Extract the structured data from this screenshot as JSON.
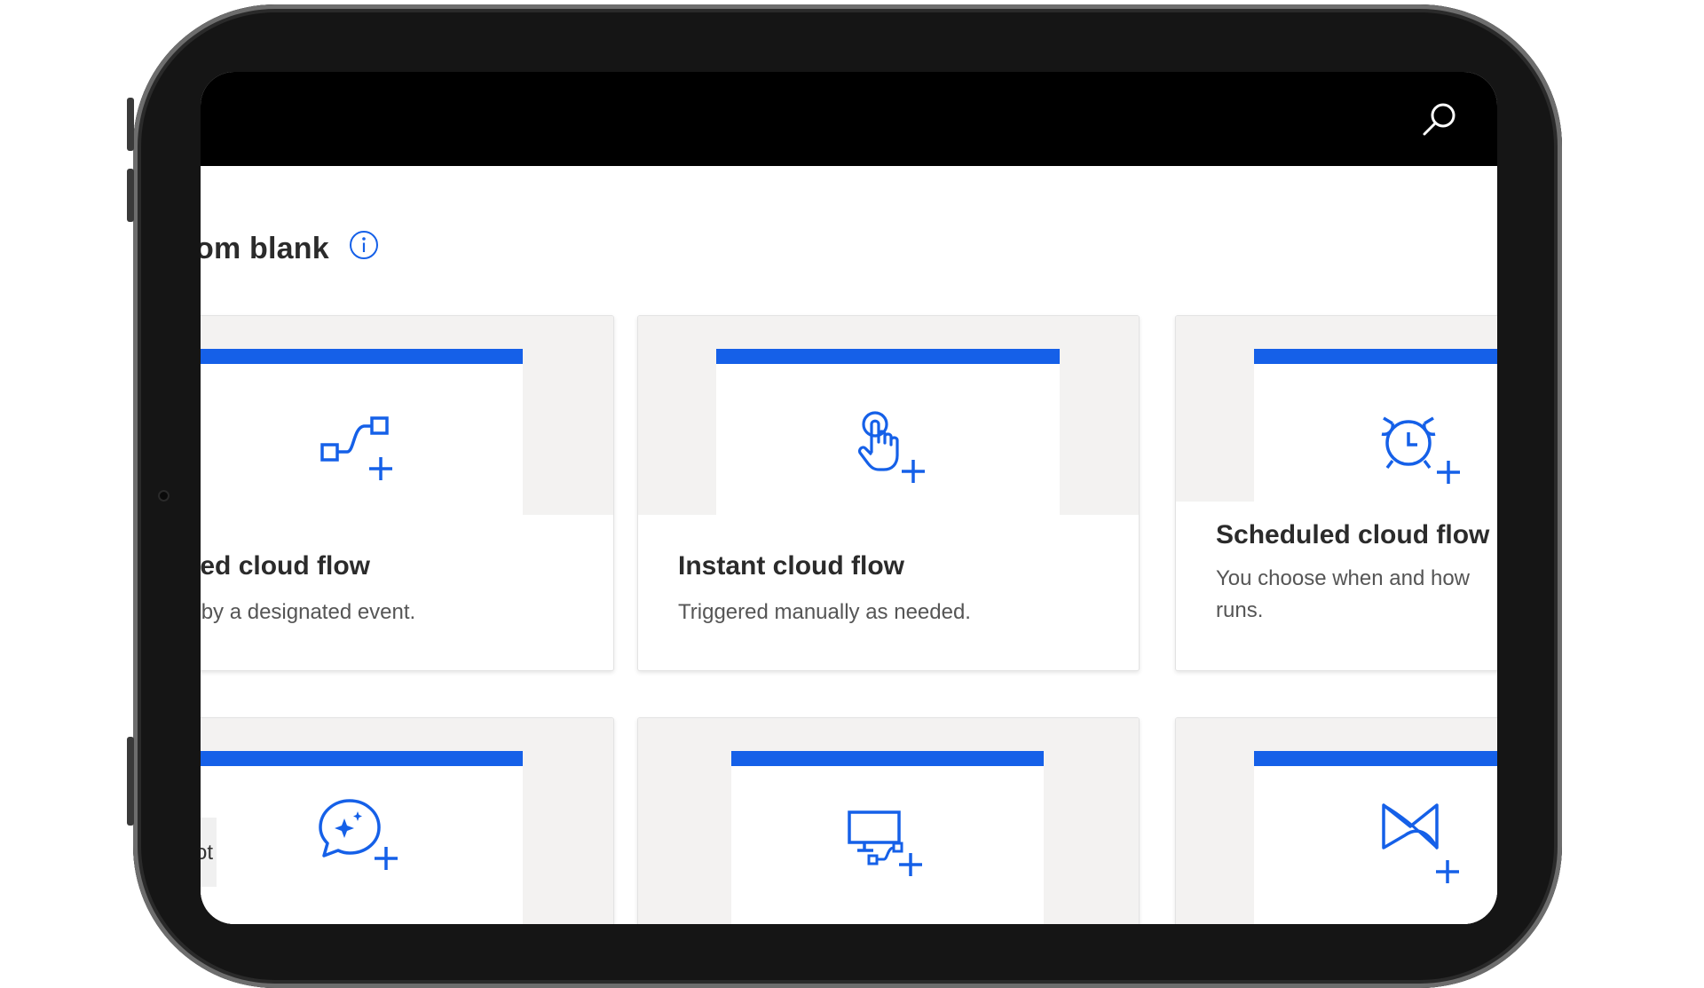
{
  "header": {
    "search_icon": "search-icon"
  },
  "section": {
    "title": "om blank",
    "info_icon": "info-icon"
  },
  "cards": [
    {
      "title": "mated cloud flow",
      "description": "ered by a designated event.",
      "icon": "automated-flow-icon"
    },
    {
      "title": "Instant cloud flow",
      "description": "Triggered manually as needed.",
      "icon": "touch-flow-icon"
    },
    {
      "title": "Scheduled cloud flow",
      "description_line1": "You choose when and how",
      "description_line2": "runs.",
      "icon": "alarm-clock-icon"
    },
    {
      "icon": "copilot-chat-icon"
    },
    {
      "icon": "desktop-flow-icon"
    },
    {
      "icon": "process-mining-icon"
    }
  ],
  "partial_label": "ot",
  "colors": {
    "accent": "#1560e8",
    "topbar": "#000000",
    "thumb_bg": "#f3f2f1"
  }
}
